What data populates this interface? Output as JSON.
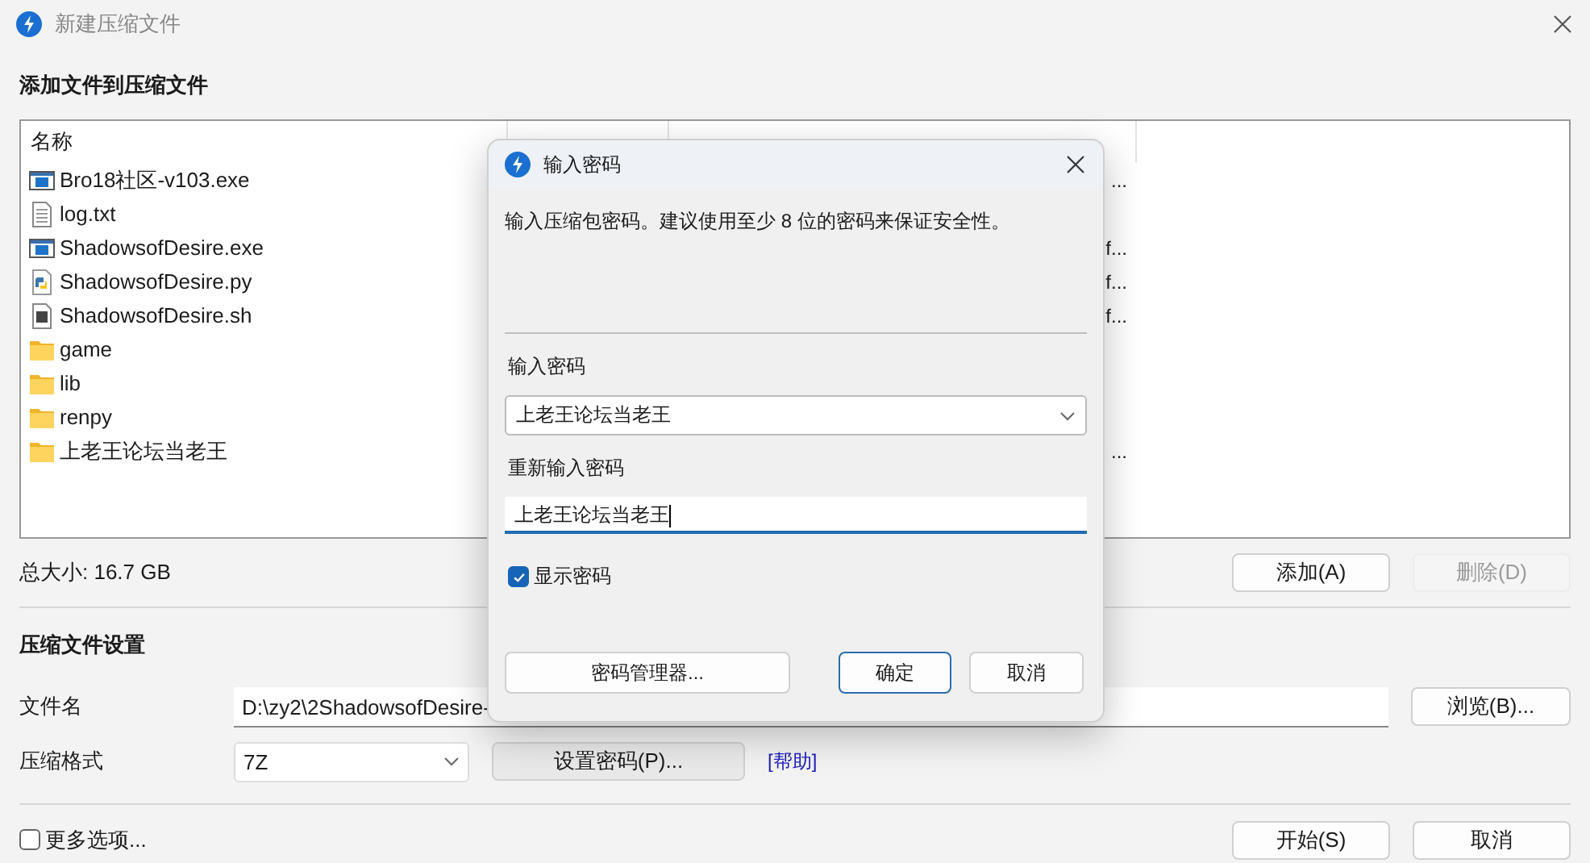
{
  "window": {
    "title": "新建压缩文件"
  },
  "add_section": {
    "title": "添加文件到压缩文件",
    "columns": [
      "名称"
    ],
    "files": [
      {
        "kind": "exe",
        "name": "Bro18社区-v103.exe",
        "path": "..."
      },
      {
        "kind": "txt",
        "name": "log.txt"
      },
      {
        "kind": "exe",
        "name": "ShadowsofDesire.exe",
        "path": "f..."
      },
      {
        "kind": "py",
        "name": "ShadowsofDesire.py",
        "path": "f..."
      },
      {
        "kind": "sh",
        "name": "ShadowsofDesire.sh",
        "path": "f..."
      },
      {
        "kind": "folder",
        "name": "game"
      },
      {
        "kind": "folder",
        "name": "lib"
      },
      {
        "kind": "folder",
        "name": "renpy"
      },
      {
        "kind": "folder",
        "name": "上老王论坛当老王",
        "path": "..."
      }
    ],
    "total": "总大小: 16.7 GB",
    "buttons": [
      {
        "label": "添加(A)",
        "disabled": false
      },
      {
        "label": "删除(D)",
        "disabled": true
      }
    ]
  },
  "settings": {
    "title": "压缩文件设置",
    "filename_label": "文件名",
    "filename": "D:\\zy2\\2ShadowsofDesire-",
    "browse": "浏览(B)...",
    "format_label": "压缩格式",
    "format": "7Z",
    "set_password": "设置密码(P)...",
    "help": "[帮助]"
  },
  "footer": {
    "more_options": {
      "label": "更多选项...",
      "checked": false
    },
    "buttons": [
      "开始(S)",
      "取消"
    ]
  },
  "dialog": {
    "title": "输入密码",
    "message": "输入压缩包密码。建议使用至少 8 位的密码来保证安全性。",
    "password_label": "输入密码",
    "password": "上老王论坛当老王",
    "confirm_label": "重新输入密码",
    "confirm": "上老王论坛当老王",
    "show_password": {
      "label": "显示密码",
      "checked": true
    },
    "manager": "密码管理器...",
    "ok": "确定",
    "cancel": "取消"
  }
}
